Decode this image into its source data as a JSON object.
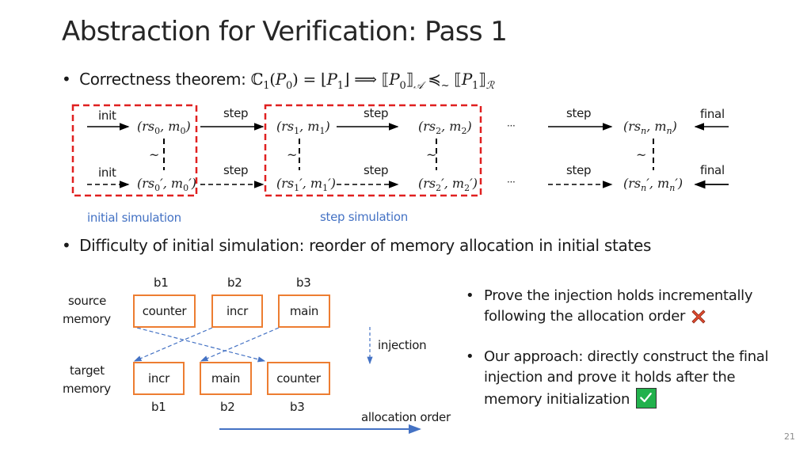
{
  "slide": {
    "title": "Abstraction for Verification: Pass 1",
    "page_number": "21"
  },
  "theorem": {
    "bullet": "•",
    "label": "Correctness theorem:",
    "formula": "ℂ₁(P₀) = ⌊P₁⌋ ⟹ ⟦P₀⟧𝒜 ≼~ ⟦P₁⟧ℛ"
  },
  "simulation_diagram": {
    "top_row": {
      "states": [
        "(rs0, m0)",
        "(rs1, m1)",
        "(rs2, m2)",
        "(rsn, mn)"
      ],
      "init_label": "init",
      "step_labels": [
        "step",
        "step",
        "step"
      ],
      "final_label": "final",
      "ellipsis": "···"
    },
    "bottom_row": {
      "states": [
        "(rs'0, m'0)",
        "(rs'1, m'1)",
        "(rs'2, m'2)",
        "(rs'n, m'n)"
      ],
      "init_label": "init",
      "step_labels": [
        "step",
        "step",
        "step"
      ],
      "final_label": "final",
      "ellipsis": "···"
    },
    "relation_symbol": "~",
    "group_labels": {
      "initial": "initial simulation",
      "step": "step simulation"
    },
    "colors": {
      "group_border": "#e02020",
      "group_label": "#4472c4"
    }
  },
  "difficulty": {
    "bullet": "•",
    "text": "Difficulty of initial simulation: reorder of memory allocation in initial states"
  },
  "memory_diagram": {
    "source_label_line1": "source",
    "source_label_line2": "memory",
    "target_label_line1": "target",
    "target_label_line2": "memory",
    "source_blocks": [
      {
        "id": "b1",
        "name": "counter"
      },
      {
        "id": "b2",
        "name": "incr"
      },
      {
        "id": "b3",
        "name": "main"
      }
    ],
    "target_blocks": [
      {
        "id": "b1",
        "name": "incr"
      },
      {
        "id": "b2",
        "name": "main"
      },
      {
        "id": "b3",
        "name": "counter"
      }
    ],
    "injection_label": "injection",
    "allocation_order_label": "allocation order",
    "colors": {
      "block_border": "#ed7d31",
      "arrow": "#4472c4"
    }
  },
  "approaches": [
    {
      "bullet": "•",
      "line1": "Prove the injection holds incrementally",
      "line2": "following the allocation order",
      "icon": "cross-icon",
      "verdict": "rejected"
    },
    {
      "bullet": "•",
      "line1": "Our approach: directly construct the final",
      "line2": "injection and prove it holds after the",
      "line3": "memory initialization",
      "icon": "check-icon",
      "verdict": "accepted"
    }
  ]
}
